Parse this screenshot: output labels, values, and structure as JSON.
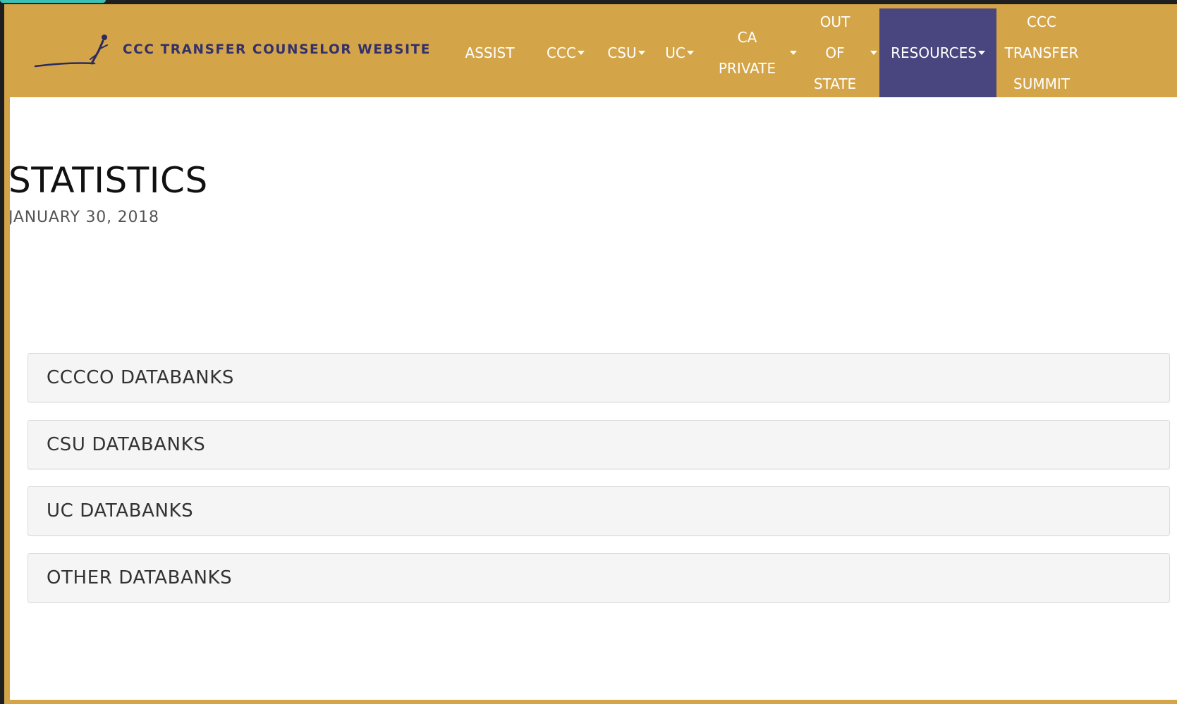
{
  "site": {
    "brand_name": "CCC TRANSFER COUNSELOR WEBSITE",
    "logo_icon": "runner-logo-icon"
  },
  "nav": {
    "assist": "ASSIST",
    "ccc": "CCC",
    "csu": "CSU",
    "uc": "UC",
    "ca_private": "CA PRIVATE",
    "out_of_state": "OUT OF STATE",
    "resources": "RESOURCES",
    "transfer_summit": "CCC TRANSFER SUMMIT",
    "dropdown_icon": "caret-down-icon"
  },
  "page": {
    "title": "STATISTICS",
    "date": "JANUARY 30, 2018"
  },
  "databanks": [
    "CCCCO DATABANKS",
    "CSU DATABANKS",
    "UC DATABANKS",
    "OTHER DATABANKS"
  ],
  "colors": {
    "nav_background": "#d4a548",
    "active_nav": "#48457f",
    "brand_text": "#33306a",
    "panel_background": "#f5f5f5"
  }
}
